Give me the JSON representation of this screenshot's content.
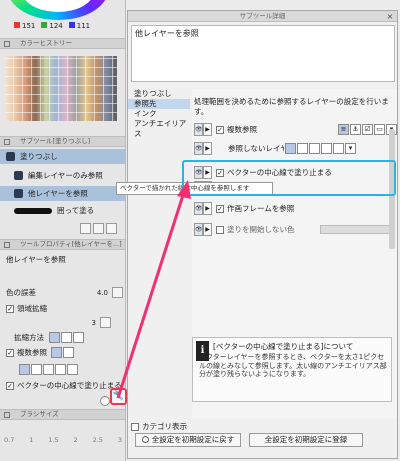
{
  "color": {
    "r": "151",
    "g": "124",
    "b": "111",
    "accent_highlight": "#29b4e6",
    "arrow": "#f03070"
  },
  "left": {
    "history_header": "カラーヒストリー",
    "subtool_header": "サブツール[塗りつぶし]",
    "subtool_group": "塗りつぶし",
    "subtool_items": [
      "編集レイヤーのみ参照",
      "他レイヤーを参照",
      "囲って塗る"
    ],
    "toolprop_header": "ツールプロパティ[他レイヤーを...]",
    "toolprop_title": "他レイヤーを参照",
    "tolerance_label": "色の誤差",
    "tolerance_value": "4.0",
    "expand_label": "領域拡縮",
    "expand_value": "3",
    "expand_method_label": "拡縮方法",
    "ref_label": "複数参照",
    "vector_line_label": "ベクターの中心線で塗り止まる",
    "brush_header": "ブラシサイズ",
    "brush_sizes": [
      "0.7",
      "1",
      "1.5",
      "2",
      "2.5",
      "3"
    ]
  },
  "dialog": {
    "title": "サブツール詳細",
    "name_value": "他レイヤーを参照",
    "categories": [
      "塗りつぶし",
      "参照先",
      "インク",
      "アンチエイリアス"
    ],
    "selected_category": 1,
    "description": "処理範囲を決めるために参照するレイヤーの設定を行います。",
    "options": [
      {
        "label": "複数参照",
        "checked": true
      },
      {
        "label": "参照しないレイヤ",
        "checked": false
      },
      {
        "label": "ベクターの中心線で塗り止まる",
        "checked": true
      },
      {
        "label": "中",
        "checked": true
      },
      {
        "label": "作画フレームを参照",
        "checked": true
      },
      {
        "label": "塗りを開始しない色",
        "checked": false
      }
    ],
    "tooltip": "ベクターで描かれた線は中心線を参照します",
    "info_title": "[ベクターの中心線で塗り止まる]について",
    "info_body": "ベクターレイヤーを参照するとき、ベクターを太さ1ピクセルの線とみなして参照します。太い線のアンチエイリアス部分が塗り残らないようになります。",
    "category_display": "カテゴリ表示",
    "reset_button": "全設定を初期設定に戻す",
    "register_button": "全設定を初期設定に登録"
  }
}
